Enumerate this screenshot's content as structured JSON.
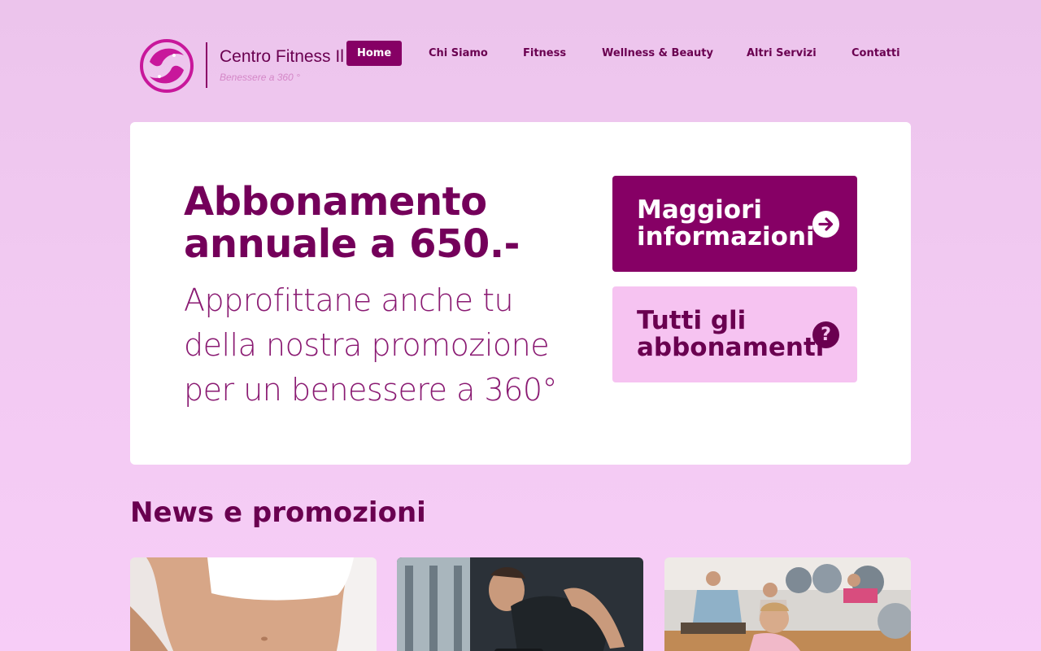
{
  "brand": {
    "name": "Centro Fitness Il Delfino",
    "tagline": "Benessere a 360 °"
  },
  "nav": {
    "items": [
      {
        "label": "Home",
        "active": true
      },
      {
        "label": "Chi Siamo",
        "active": false
      },
      {
        "label": "Fitness",
        "active": false
      },
      {
        "label": "Wellness & Beauty",
        "active": false
      },
      {
        "label": "Altri Servizi",
        "active": false
      },
      {
        "label": "Contatti",
        "active": false
      }
    ]
  },
  "hero": {
    "title": "Abbonamento annuale a 650.-",
    "subtitle": "Approfittane anche tu della nostra promozione per un benessere a 360°",
    "primary_button": {
      "label": "Maggiori informazioni",
      "icon": "arrow-right-circle-icon"
    },
    "secondary_button": {
      "label": "Tutti gli abbonamenti",
      "icon": "question-circle-icon"
    }
  },
  "news": {
    "heading": "News e promozioni",
    "cards": [
      {
        "image": "woman-waist-photo"
      },
      {
        "image": "man-dumbbell-workout-photo"
      },
      {
        "image": "group-fitness-class-photo"
      }
    ]
  },
  "colors": {
    "brand": "#860065",
    "brand_dark": "#6a0050",
    "accent_light": "#f6c3f1",
    "background": "#f1c9f1"
  }
}
